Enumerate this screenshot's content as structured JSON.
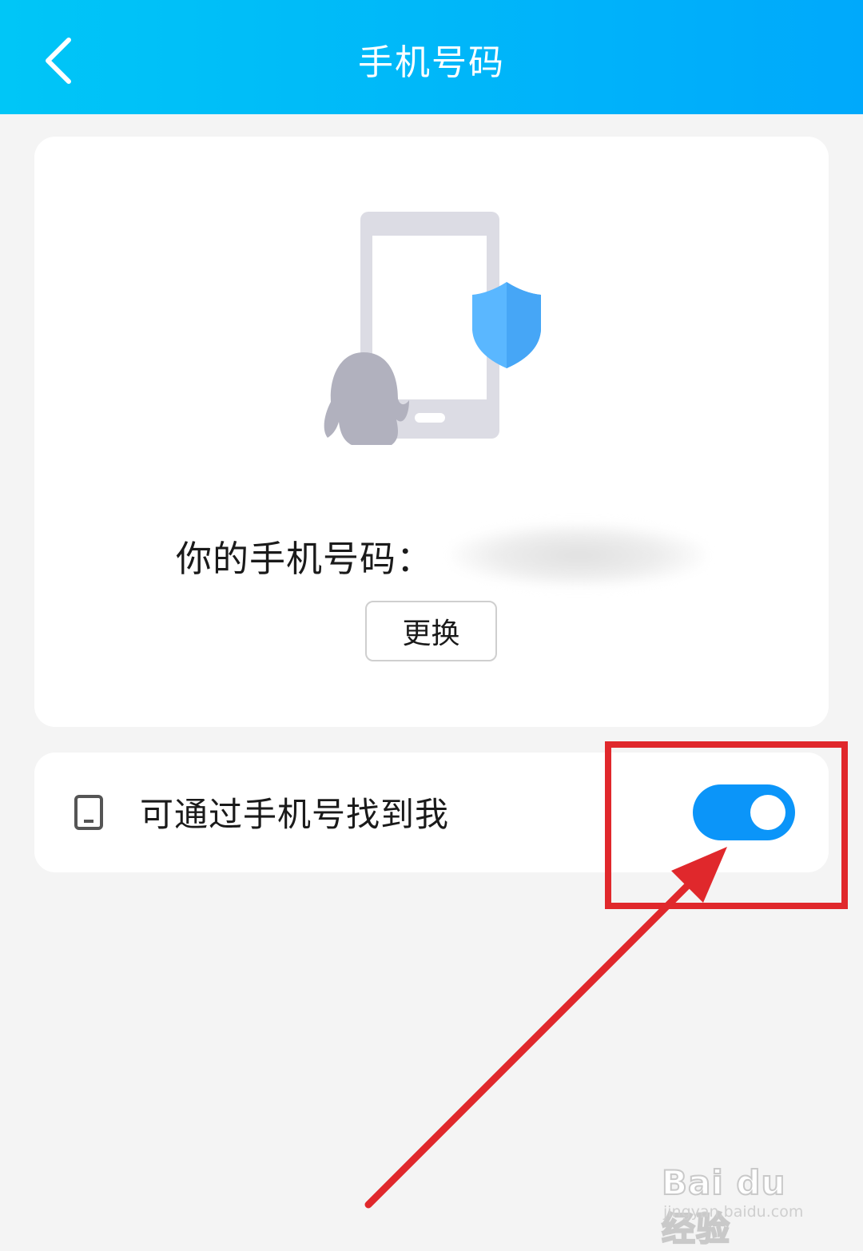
{
  "header": {
    "title": "手机号码",
    "back_icon": "chevron-left-icon"
  },
  "phone_card": {
    "label": "你的手机号码：",
    "value": "",
    "change_button": "更换"
  },
  "find_me_row": {
    "icon": "mobile-device-icon",
    "label": "可通过手机号找到我",
    "toggle_on": true
  },
  "colors": {
    "header_start": "#00c6f7",
    "header_end": "#00a9fb",
    "toggle": "#0b95f9",
    "annotation": "#e0282c"
  },
  "watermark": {
    "logo": "Bai du 经验",
    "url": "jingyan.baidu.com"
  }
}
